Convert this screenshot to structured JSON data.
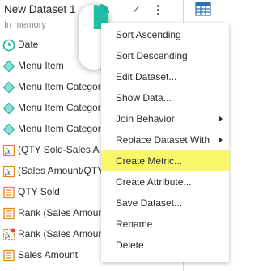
{
  "dataset": {
    "title": "New Dataset 1",
    "subtitle": "In memory"
  },
  "colors": {
    "attribute": "#1fb39a",
    "metric": "#e8861a",
    "highlight": "#fbf76b",
    "accent": "#20bfa5",
    "grid": "#2f6fb3"
  },
  "objects": [
    {
      "label": "Date",
      "icon": "clock-icon"
    },
    {
      "label": "Menu Item",
      "icon": "attribute-diamond-icon"
    },
    {
      "label": "Menu Item Categor",
      "icon": "attribute-diamond-icon"
    },
    {
      "label": "Menu Item Categor",
      "icon": "attribute-diamond-icon"
    },
    {
      "label": "Menu Item Categor",
      "icon": "attribute-diamond-icon"
    },
    {
      "label": "(QTY Sold-Sales A",
      "icon": "derived-metric-icon"
    },
    {
      "label": "(Sales Amount/QTY",
      "icon": "derived-metric-icon"
    },
    {
      "label": "QTY Sold",
      "icon": "metric-icon"
    },
    {
      "label": "Rank (Sales Amoun",
      "icon": "metric-icon"
    },
    {
      "label": "Rank (Sales Amoun",
      "icon": "derived-metric-error-icon"
    },
    {
      "label": "Sales Amount",
      "icon": "metric-icon"
    }
  ],
  "menu": {
    "items": [
      {
        "label": "Sort Ascending",
        "submenu": false
      },
      {
        "label": "Sort Descending",
        "submenu": false
      },
      {
        "label": "Edit Dataset...",
        "submenu": false
      },
      {
        "label": "Show Data...",
        "submenu": false
      },
      {
        "label": "Join Behavior",
        "submenu": true
      },
      {
        "label": "Replace Dataset With",
        "submenu": true
      },
      {
        "label": "Create Metric...",
        "submenu": false,
        "highlighted": true
      },
      {
        "label": "Create Attribute...",
        "submenu": false
      },
      {
        "label": "Save Dataset...",
        "submenu": false
      },
      {
        "label": "Rename",
        "submenu": false
      },
      {
        "label": "Delete",
        "submenu": false
      }
    ]
  }
}
